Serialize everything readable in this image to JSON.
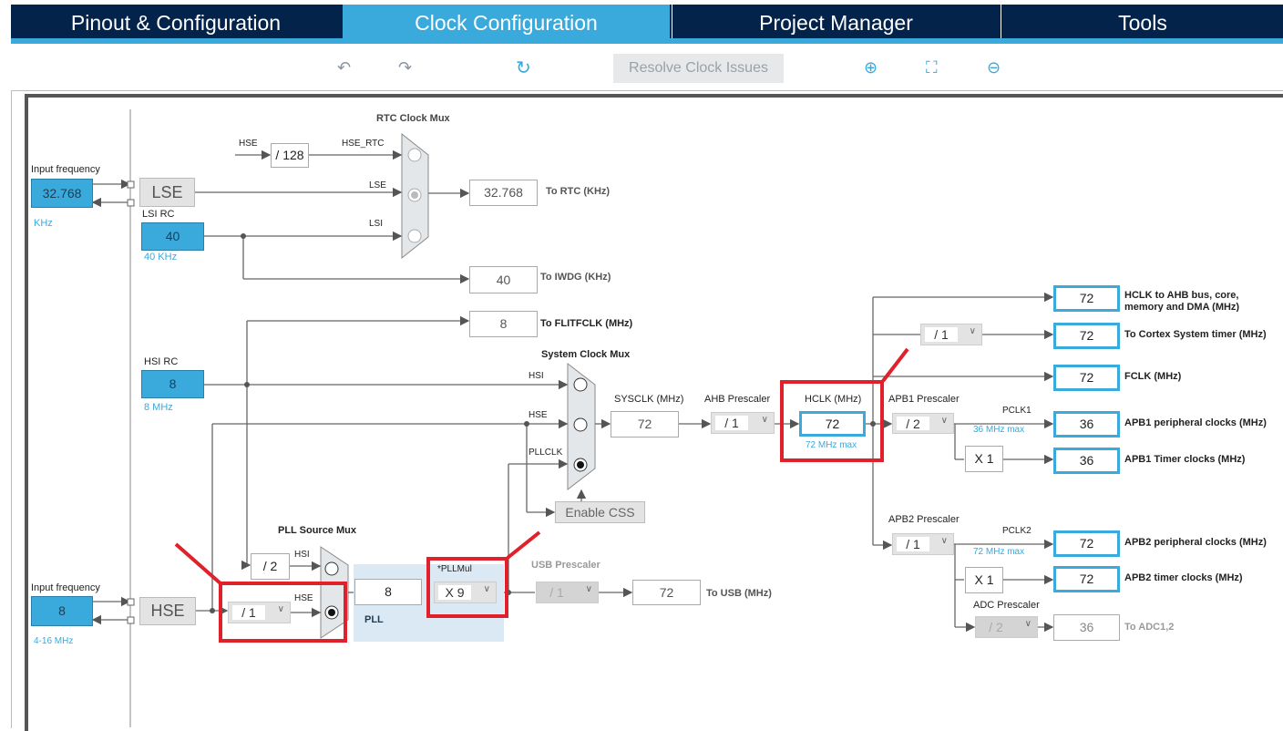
{
  "tabs": [
    {
      "label": "Pinout & Configuration"
    },
    {
      "label": "Clock Configuration",
      "active": true
    },
    {
      "label": "Project Manager"
    },
    {
      "label": "Tools"
    }
  ],
  "toolbar": {
    "undo_icon": "undo-icon",
    "redo_icon": "redo-icon",
    "reset_icon": "refresh-icon",
    "resolve_label": "Resolve Clock Issues",
    "zoom_in_icon": "zoom-in-icon",
    "fit_icon": "fit-screen-icon",
    "zoom_out_icon": "zoom-out-icon"
  },
  "colors": {
    "tab_bg": "#03234b",
    "accent": "#3aa9dc",
    "highlight": "#e0202a"
  },
  "lse": {
    "input_label": "Input frequency",
    "input_value": "32.768",
    "unit": "KHz",
    "name": "LSE"
  },
  "lsi": {
    "label": "LSI RC",
    "value": "40",
    "note": "40 KHz"
  },
  "rtc": {
    "mux_label": "RTC Clock Mux",
    "hse_label": "HSE",
    "div_value": "/ 128",
    "hse_rtc": "HSE_RTC",
    "lse_label": "LSE",
    "lsi_label": "LSI",
    "out_value": "32.768",
    "out_label": "To RTC (KHz)"
  },
  "iwdg": {
    "value": "40",
    "label": "To IWDG (KHz)"
  },
  "flitf": {
    "value": "8",
    "label": "To FLITFCLK (MHz)"
  },
  "hsi": {
    "label": "HSI RC",
    "value": "8",
    "note": "8 MHz"
  },
  "sysmux": {
    "label": "System Clock Mux",
    "hsi": "HSI",
    "hse": "HSE",
    "pllclk": "PLLCLK",
    "enable_css": "Enable CSS"
  },
  "sysclk": {
    "label": "SYSCLK (MHz)",
    "value": "72"
  },
  "ahb": {
    "label": "AHB Prescaler",
    "value": "/ 1"
  },
  "hclk": {
    "label": "HCLK (MHz)",
    "value": "72",
    "note": "72 MHz max"
  },
  "apb1": {
    "label": "APB1 Prescaler",
    "value": "/ 2",
    "pclk": "PCLK1",
    "note": "36 MHz max",
    "timer_mul": "X 1"
  },
  "apb2": {
    "label": "APB2 Prescaler",
    "value": "/ 1",
    "pclk": "PCLK2",
    "note": "72 MHz max",
    "timer_mul": "X 1"
  },
  "adc": {
    "label": "ADC Prescaler",
    "value": "/ 2"
  },
  "cortex_div": "/ 1",
  "outputs": [
    {
      "value": "72",
      "label": "HCLK to AHB bus, core, memory and DMA (MHz)"
    },
    {
      "value": "72",
      "label": "To Cortex System timer (MHz)"
    },
    {
      "value": "72",
      "label": "FCLK (MHz)"
    },
    {
      "value": "36",
      "label": "APB1 peripheral clocks (MHz)"
    },
    {
      "value": "36",
      "label": "APB1 Timer clocks (MHz)"
    },
    {
      "value": "72",
      "label": "APB2 peripheral clocks (MHz)"
    },
    {
      "value": "72",
      "label": "APB2 timer clocks (MHz)"
    },
    {
      "value": "36",
      "label": "To ADC1,2"
    }
  ],
  "pllsrc": {
    "label": "PLL Source Mux",
    "hsi": "HSI",
    "hse": "HSE",
    "hsi_div": "/ 2",
    "hse_div": "/ 1"
  },
  "pll": {
    "label": "PLL",
    "value": "8",
    "mul_label": "*PLLMul",
    "mul_value": "X 9"
  },
  "usb": {
    "label": "USB Prescaler",
    "value": "/ 1",
    "out_value": "72",
    "out_label": "To USB (MHz)"
  },
  "hse": {
    "input_label": "Input frequency",
    "input_value": "8",
    "range": "4-16 MHz",
    "name": "HSE"
  }
}
